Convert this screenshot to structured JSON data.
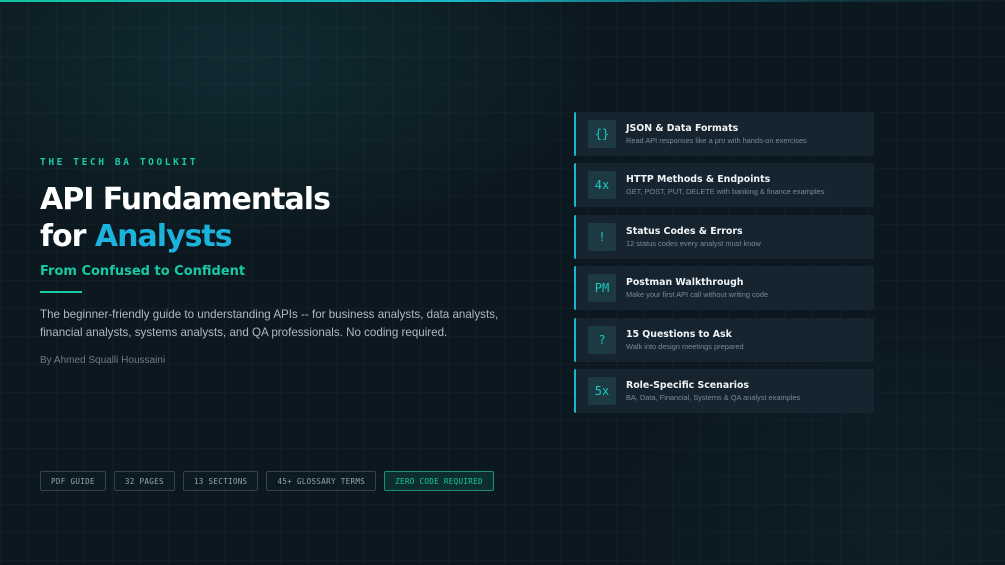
{
  "brand": {
    "eyebrow": "THE TECH BA TOOLKIT"
  },
  "hero": {
    "title_line1": "API Fundamentals",
    "title_line2_prefix": "for ",
    "title_line2_accent": "Analysts",
    "subtitle": "From Confused to Confident",
    "description": "The beginner-friendly guide to understanding APIs -- for business analysts, data analysts, financial analysts, systems analysts, and QA professionals. No coding required.",
    "byline": "By Ahmed Squalli Houssaini"
  },
  "tags": [
    "PDF GUIDE",
    "32 PAGES",
    "13 SECTIONS",
    "45+ GLOSSARY TERMS",
    "ZERO CODE REQUIRED"
  ],
  "features": [
    {
      "icon": "{}",
      "icon_name": "braces-icon",
      "title": "JSON & Data Formats",
      "subtitle": "Read API responses like a pro with hands-on exercises"
    },
    {
      "icon": "4x",
      "icon_name": "four-x-icon",
      "title": "HTTP Methods & Endpoints",
      "subtitle": "GET, POST, PUT, DELETE with banking & finance examples"
    },
    {
      "icon": "!",
      "icon_name": "exclamation-icon",
      "title": "Status Codes & Errors",
      "subtitle": "12 status codes every analyst must know"
    },
    {
      "icon": "PM",
      "icon_name": "postman-icon",
      "title": "Postman Walkthrough",
      "subtitle": "Make your first API call without writing code"
    },
    {
      "icon": "?",
      "icon_name": "question-icon",
      "title": "15 Questions to Ask",
      "subtitle": "Walk into design meetings prepared"
    },
    {
      "icon": "5x",
      "icon_name": "five-x-icon",
      "title": "Role-Specific Scenarios",
      "subtitle": "BA, Data, Financial, Systems & QA analyst examples"
    }
  ],
  "colors": {
    "background": "#0c1820",
    "teal_accent": "#19c9a3",
    "blue_accent": "#1bb3dc",
    "card_background": "#15242e"
  }
}
